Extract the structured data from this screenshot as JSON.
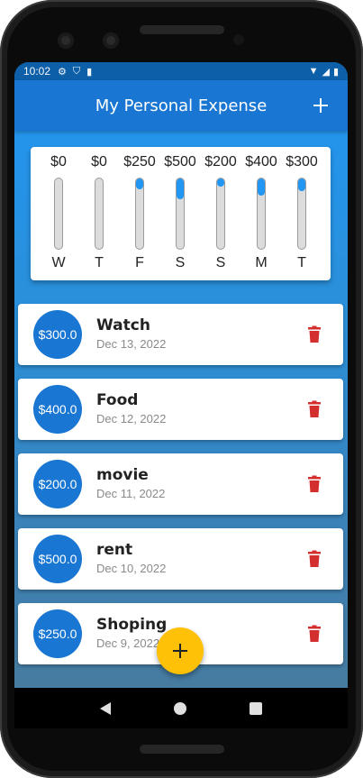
{
  "status_bar": {
    "time": "10:02"
  },
  "app_bar": {
    "title": "My Personal Expense",
    "add_icon": "plus-icon"
  },
  "chart": {
    "accent_color": "#2196f3",
    "bars": [
      {
        "amount": "$0",
        "day": "W",
        "fraction": 0.0
      },
      {
        "amount": "$0",
        "day": "T",
        "fraction": 0.0
      },
      {
        "amount": "$250",
        "day": "F",
        "fraction": 0.15
      },
      {
        "amount": "$500",
        "day": "S",
        "fraction": 0.3
      },
      {
        "amount": "$200",
        "day": "S",
        "fraction": 0.12
      },
      {
        "amount": "$400",
        "day": "M",
        "fraction": 0.24
      },
      {
        "amount": "$300",
        "day": "T",
        "fraction": 0.18
      }
    ]
  },
  "transactions": [
    {
      "amount": "$300.0",
      "title": "Watch",
      "date": "Dec 13, 2022"
    },
    {
      "amount": "$400.0",
      "title": "Food",
      "date": "Dec 12, 2022"
    },
    {
      "amount": "$200.0",
      "title": "movie",
      "date": "Dec 11, 2022"
    },
    {
      "amount": "$500.0",
      "title": "rent",
      "date": "Dec 10, 2022"
    },
    {
      "amount": "$250.0",
      "title": "Shoping",
      "date": "Dec 9, 2022"
    }
  ],
  "fab": {
    "icon": "plus-icon",
    "color": "#ffc107"
  },
  "colors": {
    "primary": "#1976d2",
    "delete": "#d32f2f"
  }
}
